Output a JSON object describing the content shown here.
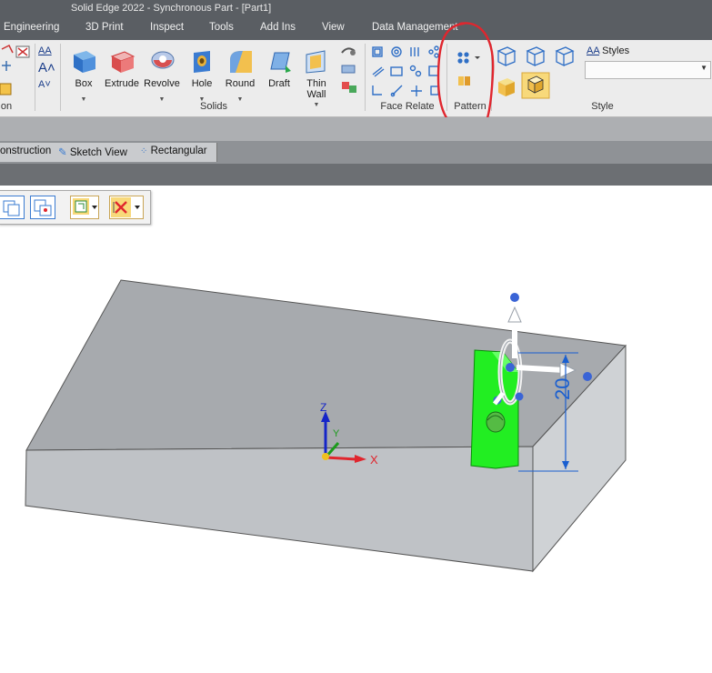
{
  "window": {
    "title": "Solid Edge 2022 - Synchronous Part - [Part1]"
  },
  "menu": {
    "items": [
      "Engineering",
      "3D Print",
      "Inspect",
      "Tools",
      "Add Ins",
      "View",
      "Data Management"
    ]
  },
  "ribbon": {
    "left_group_label": "on",
    "solids": {
      "label": "Solids",
      "buttons": [
        "Box",
        "Extrude",
        "Revolve",
        "Hole",
        "Round",
        "Draft"
      ],
      "thin_wall_line1": "Thin",
      "thin_wall_line2": "Wall"
    },
    "face_relate": {
      "label": "Face Relate"
    },
    "pattern": {
      "label": "Pattern"
    },
    "style": {
      "label": "Style",
      "styles_label": "Styles"
    }
  },
  "pathfinder": {
    "tabs": [
      "onstruction",
      "Sketch View",
      "Rectangular"
    ]
  },
  "viewport": {
    "dimension_value": "20",
    "triad": {
      "x": "X",
      "y": "Y",
      "z": "Z"
    }
  },
  "colors": {
    "annotation": "#e0262e",
    "feature_highlight": "#22ee22",
    "dimension": "#1a5fd0"
  }
}
